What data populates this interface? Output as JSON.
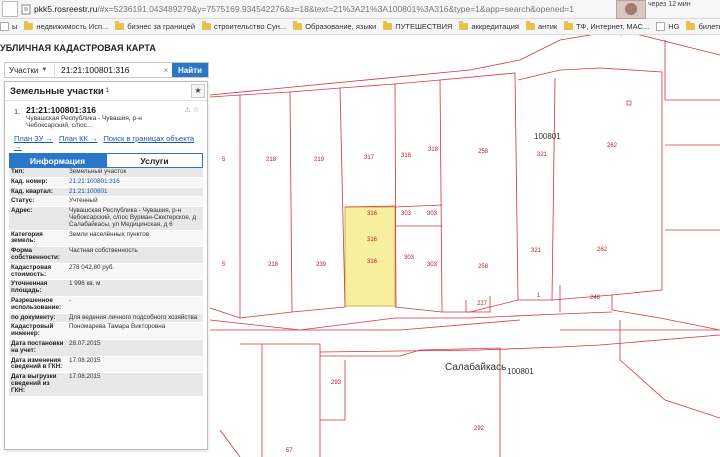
{
  "browser": {
    "url_host": "pkk5.rosreestr.ru",
    "url_rest": "/#x=5236191.043489279&y=7575169.934542276&z=18&text=21%3A21%3A100801%3A316&type=1&app=search&opened=1",
    "notification": "через 12 мин"
  },
  "bookmarks": [
    {
      "label": "ы",
      "kind": "fav"
    },
    {
      "label": "недвижимость Исп...",
      "kind": "folder"
    },
    {
      "label": "бизнес за границей",
      "kind": "folder"
    },
    {
      "label": "строительство Сун...",
      "kind": "folder"
    },
    {
      "label": "Образование, языки",
      "kind": "folder"
    },
    {
      "label": "ПУТЕШЕСТВИЯ",
      "kind": "folder"
    },
    {
      "label": "аккредитация",
      "kind": "folder"
    },
    {
      "label": "антик",
      "kind": "folder"
    },
    {
      "label": "ТФ, Интернет, МАС...",
      "kind": "folder"
    },
    {
      "label": "HG",
      "kind": "fav"
    },
    {
      "label": "билеты концерты",
      "kind": "folder"
    }
  ],
  "page": {
    "title": "УБЛИЧНАЯ КАДАСТРОВАЯ КАРТА"
  },
  "search": {
    "type": "Участки",
    "value": "21:21:100801:316",
    "button": "Найти"
  },
  "panel": {
    "header": "Земельные участки",
    "header_sup": "1",
    "result_number": "1.",
    "cad_number": "21:21:100801:316",
    "address_short": "Чувашская Республика - Чувашия, р-н Чебоксарский, с/пос...",
    "links": [
      "План ЗУ →",
      "План КК →",
      "Поиск в границах объекта →"
    ],
    "tabs": {
      "info": "Информация",
      "services": "Услуги"
    },
    "properties": [
      {
        "label": "Тип:",
        "value": "Земельный участок"
      },
      {
        "label": "Кад. номер:",
        "value": "21:21:100801:316",
        "link": true
      },
      {
        "label": "Кад. квартал:",
        "value": "21:21:100801",
        "link": true
      },
      {
        "label": "Статус:",
        "value": "Учтенный"
      },
      {
        "label": "Адрес:",
        "value": "Чувашская Республика - Чувашия, р-н Чебоксарский, с/пос Вурман-Сюктерское, д Салабайкасы, ул Медицинская, д 6"
      },
      {
        "label": "Категория земель:",
        "value": "Земли населённых пунктов"
      },
      {
        "label": "Форма собственности:",
        "value": "Частная собственность"
      },
      {
        "label": "Кадастровая стоимость:",
        "value": "278 042,80 руб."
      },
      {
        "label": "Уточненная площадь:",
        "value": "1 996 кв. м"
      },
      {
        "label": "Разрешенное использование:",
        "value": "-"
      },
      {
        "label": "по документу:",
        "value": "Для ведения личного подсобного хозяйства"
      },
      {
        "label": "Кадастровый инженер:",
        "value": "Пономарева Тамара Викторовна"
      },
      {
        "label": "Дата постановки на учет:",
        "value": "28.07.2015"
      },
      {
        "label": "Дата изменения сведений в ГКН:",
        "value": "17.08.2015"
      },
      {
        "label": "Дата выгрузки сведений из ГКН:",
        "value": "17.08.2015"
      }
    ]
  },
  "map": {
    "labels": [
      "5",
      "218",
      "219",
      "317",
      "318",
      "318",
      "258",
      "100801",
      "321",
      "262",
      "316",
      "303",
      "303",
      "316",
      "303",
      "5",
      "218",
      "239",
      "316",
      "303",
      "258",
      "321",
      "262",
      "227",
      "1",
      "246",
      "100801",
      "293",
      "57",
      "292"
    ],
    "street": "Салабайкась",
    "highlight_color": "#f7ef9e",
    "line_color": "#d8343e"
  }
}
